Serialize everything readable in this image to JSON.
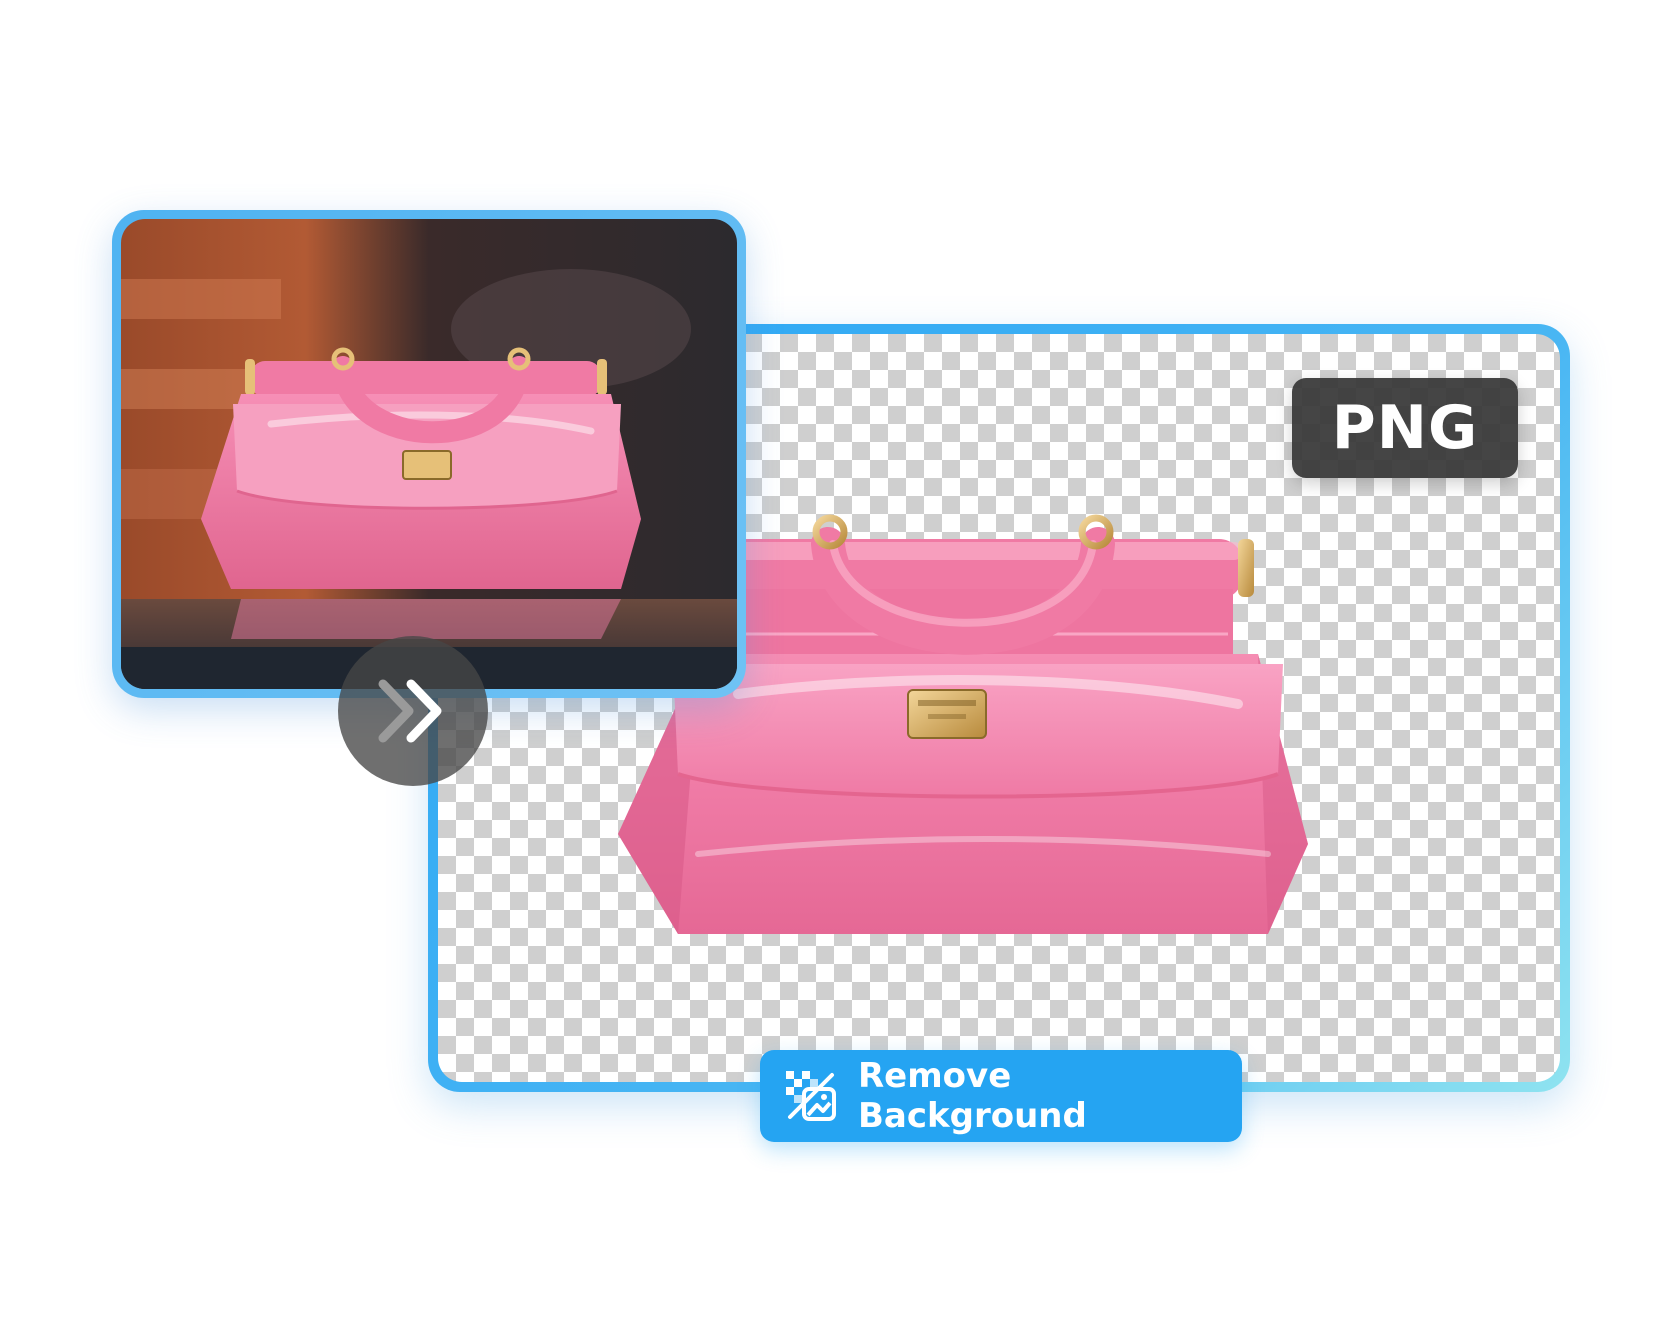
{
  "result": {
    "format_label": "PNG"
  },
  "action": {
    "remove_background_label": "Remove Background"
  },
  "icons": {
    "arrow": "double-chevron-right-icon",
    "remove_bg": "remove-background-icon",
    "product": "handbag"
  },
  "colors": {
    "accent": "#25a4f2",
    "card_border": "#4fb3f2",
    "bag_pink": "#f07aa4",
    "badge_bg": "#373737"
  }
}
